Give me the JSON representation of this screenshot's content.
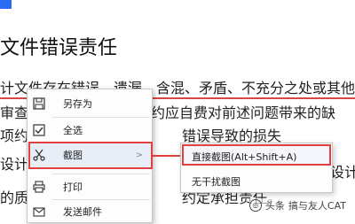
{
  "document": {
    "top_fragment": "",
    "heading": "文件错误责任",
    "lines": [
      "计文件存在错误、遗漏、含混、矛盾、不充分之处或其他",
      "审查",
      "约应自费对前述问题带来的缺",
      "项约",
      "错误导致的损失",
      "设计",
      "设计",
      "的质",
      "约定承担责任。"
    ]
  },
  "context_menu": {
    "items": [
      {
        "label": "另存为",
        "icon": "save-icon"
      },
      {
        "label": "全选",
        "icon": "select-all-icon"
      },
      {
        "label": "截图",
        "icon": "scissors-icon"
      },
      {
        "label": "打印",
        "icon": "printer-icon"
      },
      {
        "label": "发送邮件",
        "icon": "mail-icon"
      }
    ],
    "highlighted_item": "截图"
  },
  "submenu": {
    "items": [
      {
        "label": "直接截图(Alt+Shift+A)"
      },
      {
        "label": "无干扰截图"
      }
    ]
  },
  "watermark": {
    "text": "搞与友人CAT",
    "prefix": "头条"
  },
  "colors": {
    "highlight_border": "#e04040",
    "arrow": "#e04040",
    "menu_bg": "#fdfdfd"
  }
}
